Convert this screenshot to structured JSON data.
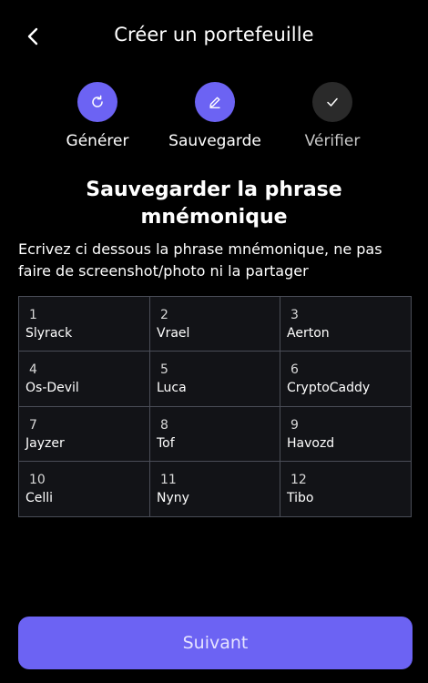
{
  "header": {
    "title": "Créer un portefeuille",
    "back_icon": "chevron-left-icon"
  },
  "steps": [
    {
      "label": "Générer",
      "icon": "refresh-icon",
      "state": "active"
    },
    {
      "label": "Sauvegarde",
      "icon": "pencil-icon",
      "state": "active"
    },
    {
      "label": "Vérifier",
      "icon": "check-icon",
      "state": "inactive"
    }
  ],
  "heading": "Sauvegarder la phrase mnémonique",
  "instruction": "Ecrivez ci dessous la phrase mnémonique, ne pas faire de screenshot/photo ni la partager",
  "words": [
    {
      "num": "1",
      "word": "Slyrack"
    },
    {
      "num": "2",
      "word": "Vrael"
    },
    {
      "num": "3",
      "word": "Aerton"
    },
    {
      "num": "4",
      "word": "Os-Devil"
    },
    {
      "num": "5",
      "word": "Luca"
    },
    {
      "num": "6",
      "word": "CryptoCaddy"
    },
    {
      "num": "7",
      "word": "Jayzer"
    },
    {
      "num": "8",
      "word": "Tof"
    },
    {
      "num": "9",
      "word": "Havozd"
    },
    {
      "num": "10",
      "word": "Celli"
    },
    {
      "num": "11",
      "word": "Nyny"
    },
    {
      "num": "12",
      "word": "Tibo"
    }
  ],
  "next_label": "Suivant",
  "colors": {
    "accent": "#6c63f3",
    "background": "#000000",
    "inactive_step": "#2a2a2a"
  }
}
